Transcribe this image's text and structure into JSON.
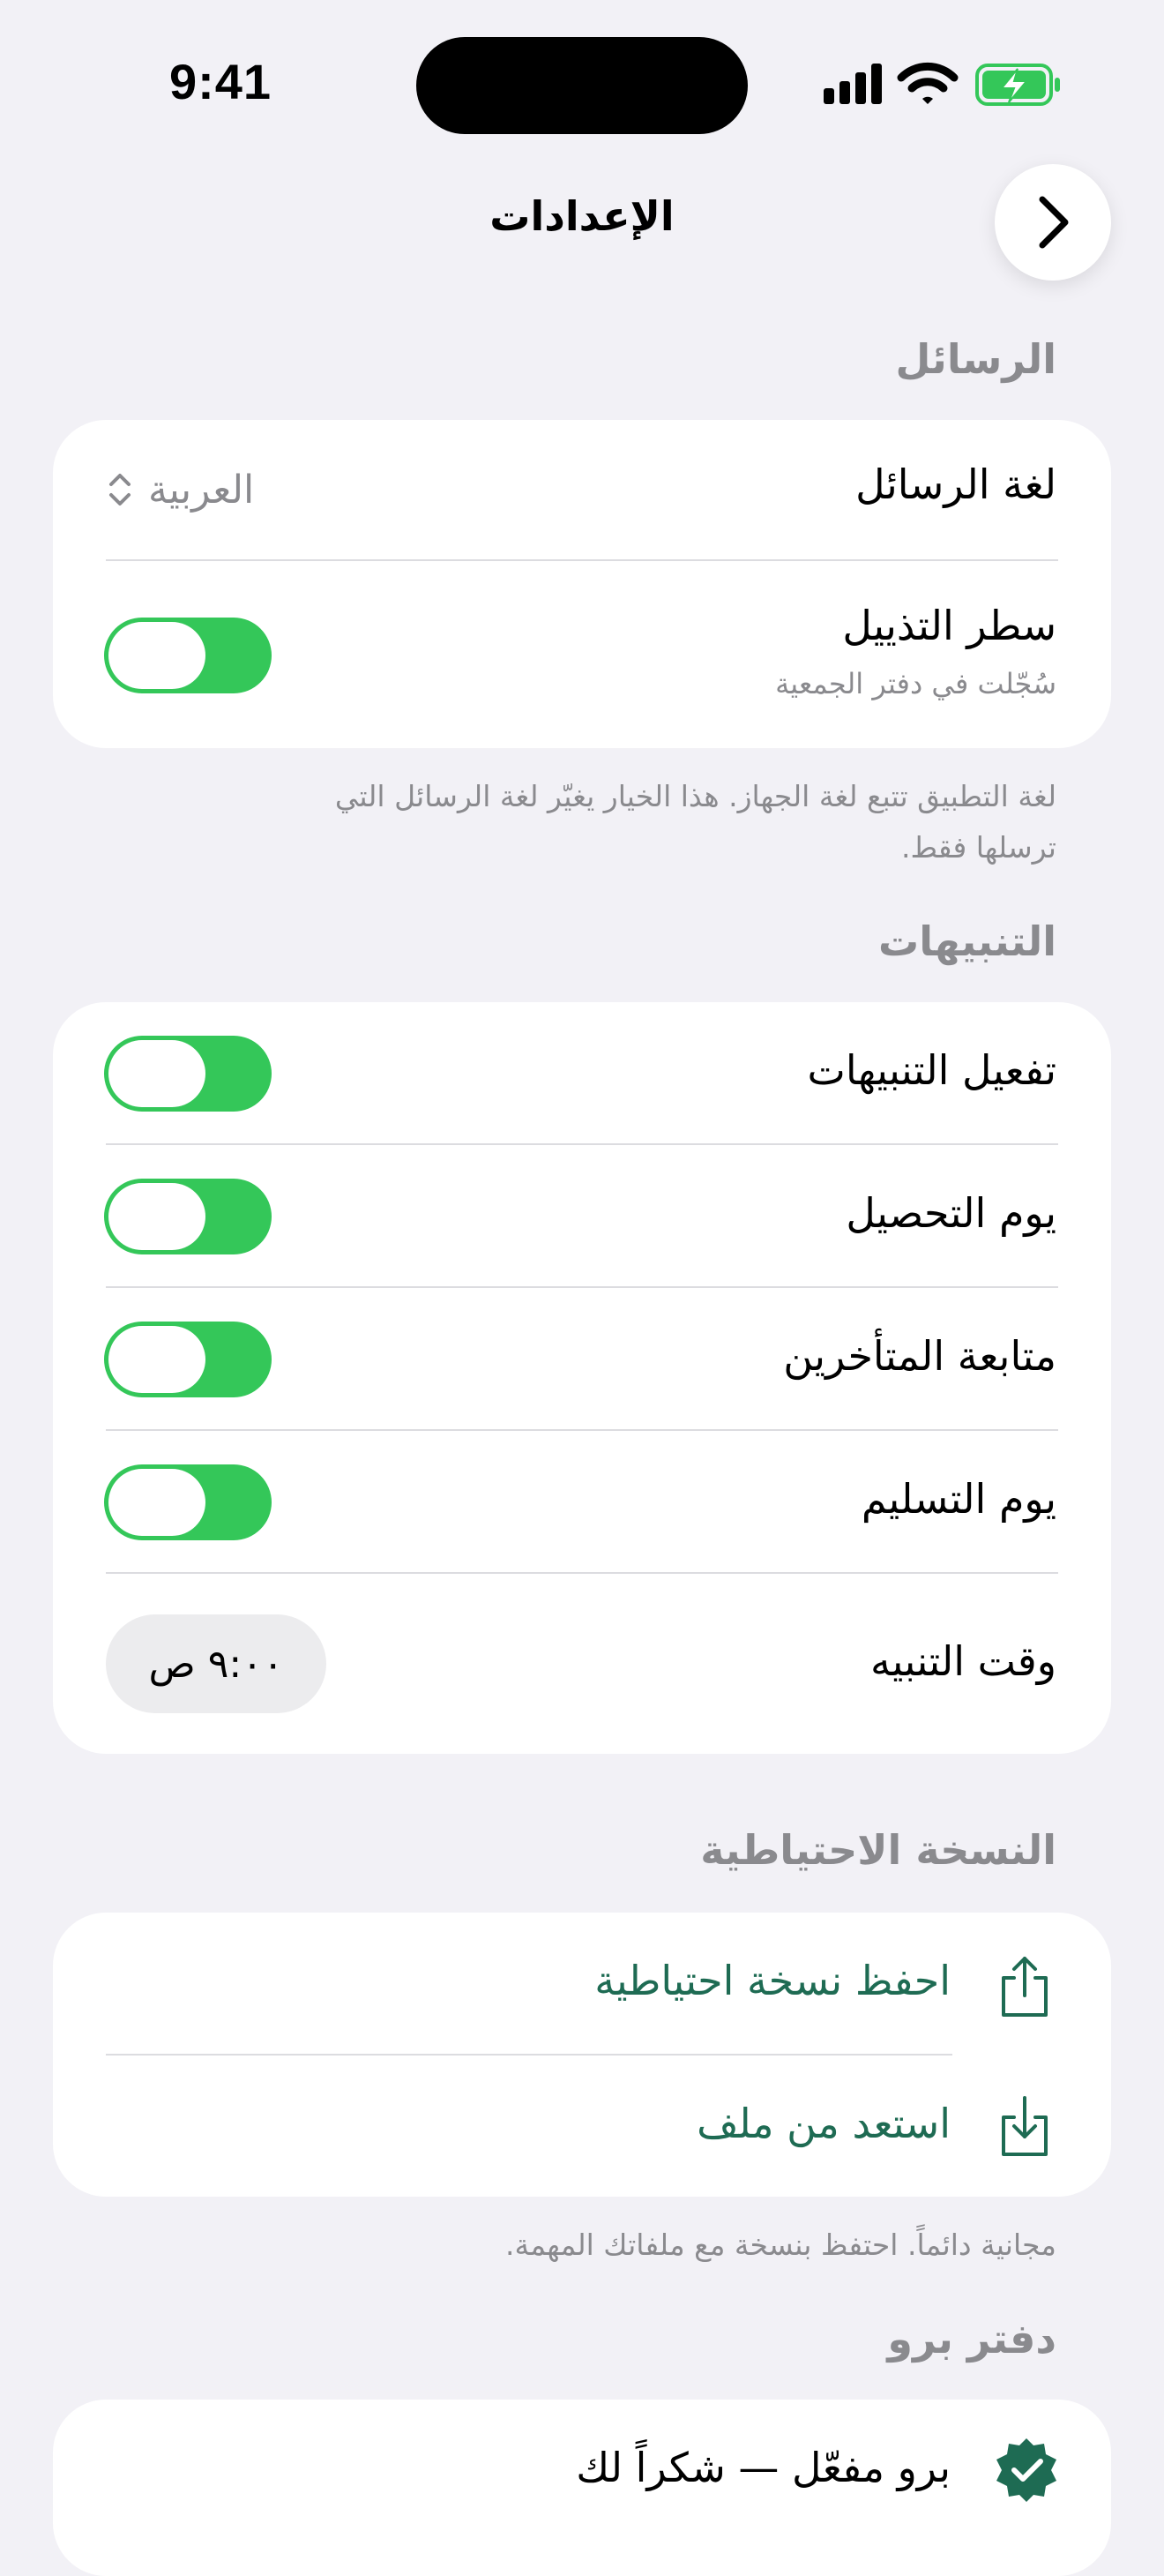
{
  "status_bar": {
    "time": "9:41"
  },
  "nav": {
    "title": "الإعدادات"
  },
  "messages": {
    "section_title": "الرسائل",
    "language_label": "لغة الرسائل",
    "language_value": "العربية",
    "footer_line_label": "سطر التذييل",
    "footer_line_sub": "سُجّلت في دفتر الجمعية",
    "footer_line_on": true,
    "footnote": "لغة التطبيق تتبع لغة الجهاز. هذا الخيار يغيّر لغة الرسائل التي ترسلها فقط."
  },
  "notifications": {
    "section_title": "التنبيهات",
    "items": [
      {
        "label": "تفعيل التنبيهات",
        "on": true
      },
      {
        "label": "يوم التحصيل",
        "on": true
      },
      {
        "label": "متابعة المتأخرين",
        "on": true
      },
      {
        "label": "يوم التسليم",
        "on": true
      }
    ],
    "time_label": "وقت التنبيه",
    "time_value": "٩:٠٠ ص"
  },
  "backup": {
    "section_title": "النسخة الاحتياطية",
    "save_label": "احفظ نسخة احتياطية",
    "restore_label": "استعد من ملف",
    "footnote": "مجانية دائماً. احتفظ بنسخة مع ملفاتك المهمة."
  },
  "pro": {
    "section_title": "دفتر برو",
    "status_label": "برو مفعّل — شكراً لك"
  },
  "colors": {
    "accent_green": "#1e6b53",
    "toggle_green": "#34c759",
    "background": "#f2f1f6"
  }
}
